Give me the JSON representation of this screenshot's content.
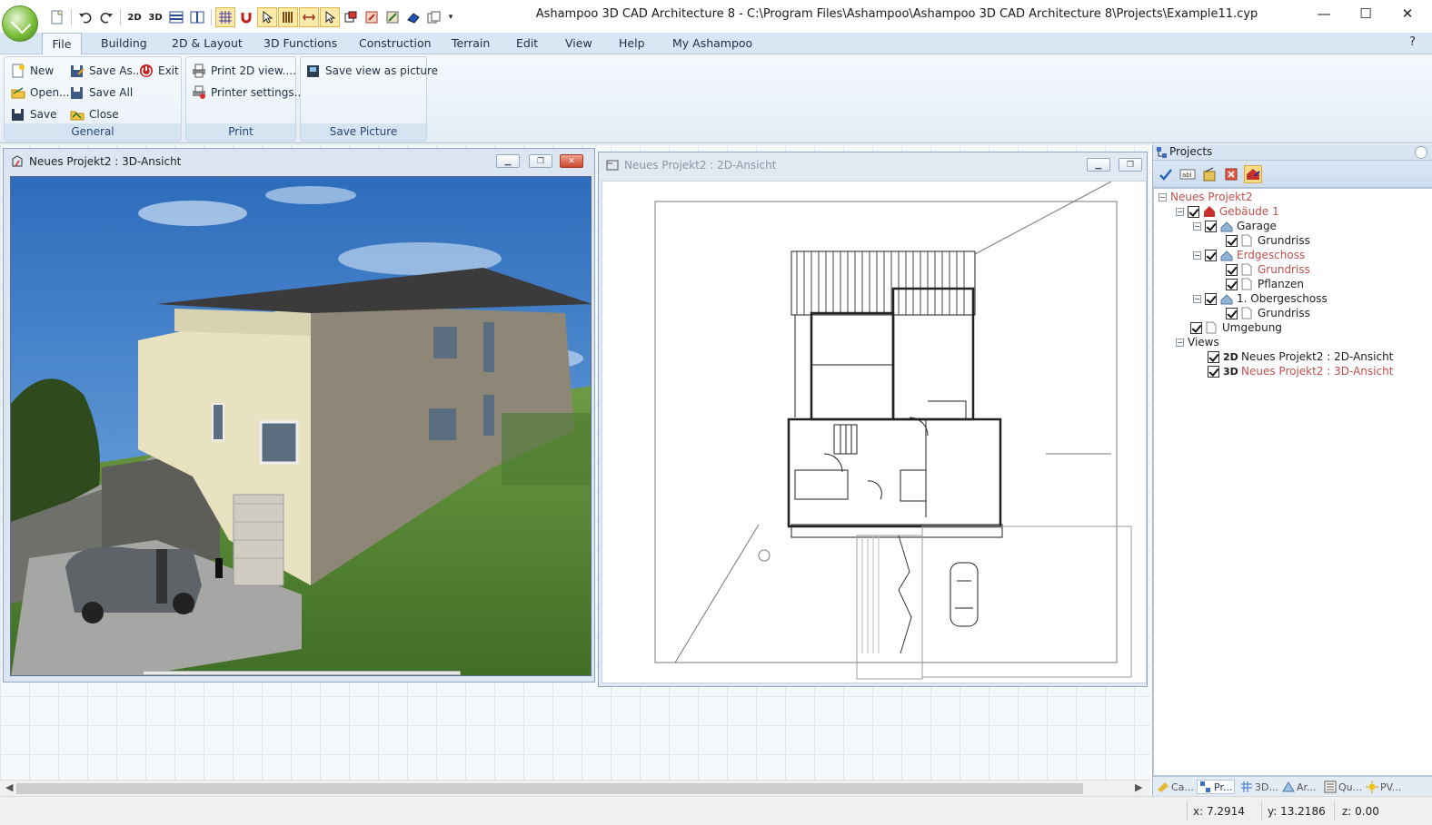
{
  "window": {
    "title": "Ashampoo 3D CAD Architecture 8 - C:\\Program Files\\Ashampoo\\Ashampoo 3D CAD Architecture 8\\Projects\\Example11.cyp",
    "minimize_glyph": "—",
    "maximize_glyph": "☐",
    "close_glyph": "✕"
  },
  "quick_access": {
    "icons": [
      "new-doc-icon",
      "undo-icon",
      "redo-icon",
      "2d-view-icon",
      "3d-view-icon",
      "horizontal-split-icon",
      "vertical-split-icon",
      "grid-icon",
      "magnet-icon",
      "select-pointer-icon",
      "ruler-icon",
      "measure-icon",
      "cursor-icon",
      "window-icon",
      "move-icon",
      "transform-icon",
      "eraser-icon",
      "copy-icon",
      "customize-arrow-icon"
    ]
  },
  "menu": {
    "items": [
      "File",
      "Building",
      "2D & Layout",
      "3D Functions",
      "Construction",
      "Terrain",
      "Edit",
      "View",
      "Help",
      "My Ashampoo"
    ],
    "help_glyph": "?"
  },
  "ribbon": {
    "groups": [
      {
        "label": "General",
        "buttons": [
          "New",
          "Save As...",
          "Exit",
          "Open...",
          "Save All",
          "Save",
          "Close"
        ]
      },
      {
        "label": "Print",
        "buttons": [
          "Print 2D view....",
          "Printer settings..."
        ]
      },
      {
        "label": "Save Picture",
        "buttons": [
          "Save view as picture"
        ]
      }
    ]
  },
  "windows": {
    "view3d_title": "Neues Projekt2 : 3D-Ansicht",
    "view2d_title": "Neues Projekt2 : 2D-Ansicht"
  },
  "projects_panel": {
    "title": "Projects",
    "tree": [
      {
        "label": "Neues Projekt2",
        "red": true
      },
      {
        "label": "Gebäude 1",
        "red": true
      },
      {
        "label": "Garage",
        "red": false
      },
      {
        "label": "Grundriss",
        "red": false
      },
      {
        "label": "Erdgeschoss",
        "red": true
      },
      {
        "label": "Grundriss",
        "red": true
      },
      {
        "label": "Pflanzen",
        "red": false
      },
      {
        "label": "1. Obergeschoss",
        "red": false
      },
      {
        "label": "Grundriss",
        "red": false
      },
      {
        "label": "Umgebung",
        "red": false
      },
      {
        "label": "Views",
        "red": false
      },
      {
        "label": "Neues Projekt2 : 2D-Ansicht",
        "tag": "2D",
        "red": false
      },
      {
        "label": "Neues Projekt2 : 3D-Ansicht",
        "tag": "3D",
        "red": true
      }
    ],
    "tabs": [
      "Ca...",
      "Pr...",
      "3D...",
      "Ar...",
      "Qu...",
      "PV..."
    ]
  },
  "status": {
    "x": "x: 7.2914",
    "y": "y: 13.2186",
    "z": "z: 0.00"
  },
  "colors": {
    "accent": "#c0504d",
    "ribbon_bg": "#e4edf7",
    "menu_bg": "#d9e6f3"
  }
}
